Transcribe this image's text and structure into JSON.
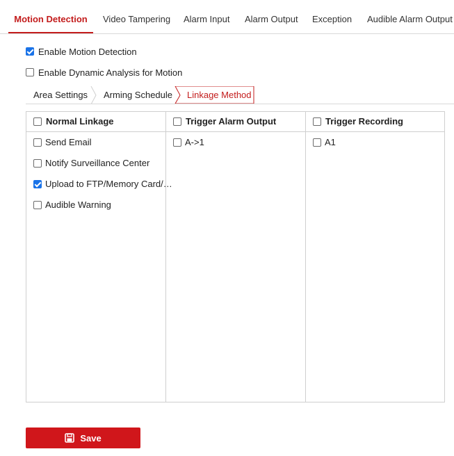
{
  "tabs": [
    {
      "label": "Motion Detection",
      "active": true
    },
    {
      "label": "Video Tampering"
    },
    {
      "label": "Alarm Input"
    },
    {
      "label": "Alarm Output"
    },
    {
      "label": "Exception"
    },
    {
      "label": "Audible Alarm Output"
    }
  ],
  "options": {
    "enable_motion": {
      "label": "Enable Motion Detection",
      "checked": true
    },
    "enable_dynamic": {
      "label": "Enable Dynamic Analysis for Motion",
      "checked": false
    }
  },
  "subtabs": [
    {
      "label": "Area Settings"
    },
    {
      "label": "Arming Schedule"
    },
    {
      "label": "Linkage Method",
      "active": true
    }
  ],
  "columns": {
    "normal": {
      "header": "Normal Linkage",
      "items": [
        {
          "label": "Send Email",
          "checked": false
        },
        {
          "label": "Notify Surveillance Center",
          "checked": false
        },
        {
          "label": "Upload to FTP/Memory Card/…",
          "checked": true
        },
        {
          "label": "Audible Warning",
          "checked": false
        }
      ]
    },
    "alarm_output": {
      "header": "Trigger Alarm Output",
      "items": [
        {
          "label": "A->1",
          "checked": false
        }
      ]
    },
    "recording": {
      "header": "Trigger Recording",
      "items": [
        {
          "label": "A1",
          "checked": false
        }
      ]
    }
  },
  "save": {
    "label": "Save",
    "icon": "save-icon"
  },
  "colors": {
    "accent": "#c31c1c",
    "button": "#d0161b",
    "checkbox_checked": "#1a73e8"
  }
}
